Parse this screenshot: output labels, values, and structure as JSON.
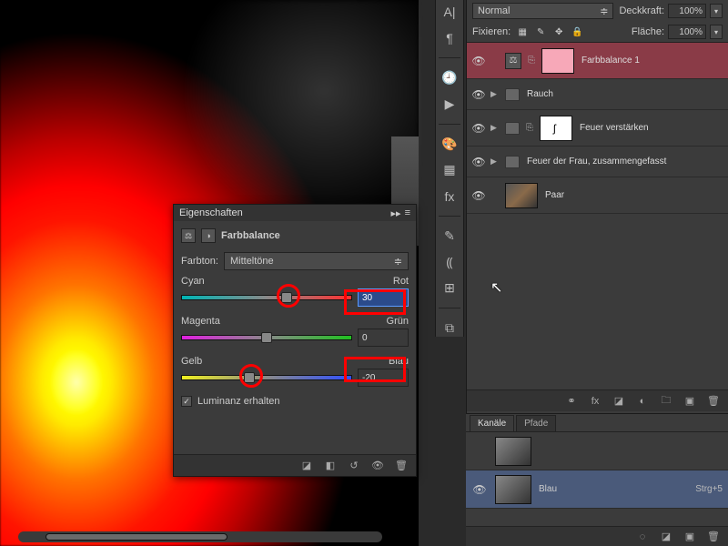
{
  "props": {
    "panel_title": "Eigenschaften",
    "adjustment_name": "Farbbalance",
    "tone_label": "Farbton:",
    "tone_value": "Mitteltöne",
    "sliders": {
      "cr": {
        "left": "Cyan",
        "right": "Rot",
        "value": "30",
        "pos": 62
      },
      "mg": {
        "left": "Magenta",
        "right": "Grün",
        "value": "0",
        "pos": 50
      },
      "yb": {
        "left": "Gelb",
        "right": "Blau",
        "value": "-20",
        "pos": 40
      }
    },
    "preserve_lum": "Luminanz erhalten"
  },
  "layers": {
    "blend_mode": "Normal",
    "opacity_label": "Deckkraft:",
    "opacity_value": "100%",
    "lock_label": "Fixieren:",
    "fill_label": "Fläche:",
    "fill_value": "100%",
    "items": [
      {
        "name": "Farbbalance 1",
        "type": "adj",
        "selected": true
      },
      {
        "name": "Rauch",
        "type": "group"
      },
      {
        "name": "Feuer verstärken",
        "type": "group_mask"
      },
      {
        "name": "Feuer der Frau, zusammengefasst",
        "type": "group"
      },
      {
        "name": "Paar",
        "type": "image"
      }
    ]
  },
  "channels": {
    "tab_channels": "Kanäle",
    "tab_paths": "Pfade",
    "items": [
      {
        "name": "",
        "shortcut": ""
      },
      {
        "name": "Blau",
        "shortcut": "Strg+5"
      }
    ]
  }
}
